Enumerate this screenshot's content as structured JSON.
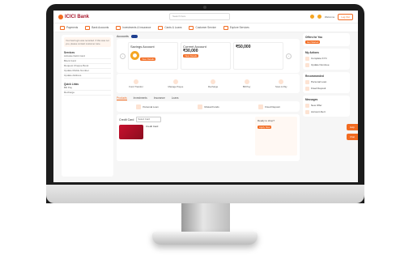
{
  "brand": {
    "name": "ICICI Bank",
    "accent": "#f26b21",
    "brand_red": "#a8192e"
  },
  "header": {
    "search_placeholder": "Search here",
    "user_name": "Welcome",
    "logout_label": "Log Out"
  },
  "nav": {
    "items": [
      {
        "label": "Payments",
        "icon": "wallet-icon"
      },
      {
        "label": "Bank Accounts",
        "icon": "bank-icon"
      },
      {
        "label": "Investments & Insurance",
        "icon": "chart-icon"
      },
      {
        "label": "Cards & Loans",
        "icon": "card-icon"
      },
      {
        "label": "Customer Service",
        "icon": "headset-icon"
      },
      {
        "label": "Explore Services",
        "icon": "compass-icon"
      }
    ]
  },
  "left_panel": {
    "notice": "Your last login was recorded. If this was not you, please contact customer care.",
    "sections": [
      {
        "title": "Services",
        "links": [
          "Activate Debit Card",
          "Block Card",
          "Request Cheque Book",
          "Update Mobile Number",
          "Update Address"
        ]
      },
      {
        "title": "Quick Links",
        "links": [
          "Bill Pay",
          "Recharge"
        ]
      }
    ]
  },
  "accounts": {
    "title": "Accounts",
    "cards": [
      {
        "label": "Savings Account",
        "value": "₹50,000",
        "action": "View Details"
      },
      {
        "label": "Current Account",
        "value": "₹30,000",
        "action": "View Details"
      }
    ]
  },
  "quick_actions": [
    "Fund Transfer",
    "Manage Payee",
    "Recharge",
    "Bill Pay",
    "Scan & Pay"
  ],
  "tabs": [
    "Products",
    "Investments",
    "Insurance",
    "Loans"
  ],
  "products": [
    "Personal Loan",
    "Mutual Funds",
    "Fixed Deposit"
  ],
  "credit_card": {
    "title": "Credit Card",
    "select_placeholder": "Select Card",
    "card_name": "Credit Card",
    "promo_title": "Ready to shop?",
    "promo_action": "Apply Now"
  },
  "right_panel": {
    "offers": {
      "title": "Offers for You",
      "action": "Get Started"
    },
    "my_actions": {
      "title": "My Actions",
      "items": [
        "Complete KYC",
        "Update Nominee"
      ]
    },
    "recommended": {
      "title": "Recommended",
      "items": [
        "Personal Loan",
        "Fixed Deposit"
      ]
    },
    "messages": {
      "title": "Messages",
      "items": [
        "New Offer",
        "Account Alert"
      ]
    }
  },
  "floating": [
    "Help",
    "Chat"
  ]
}
